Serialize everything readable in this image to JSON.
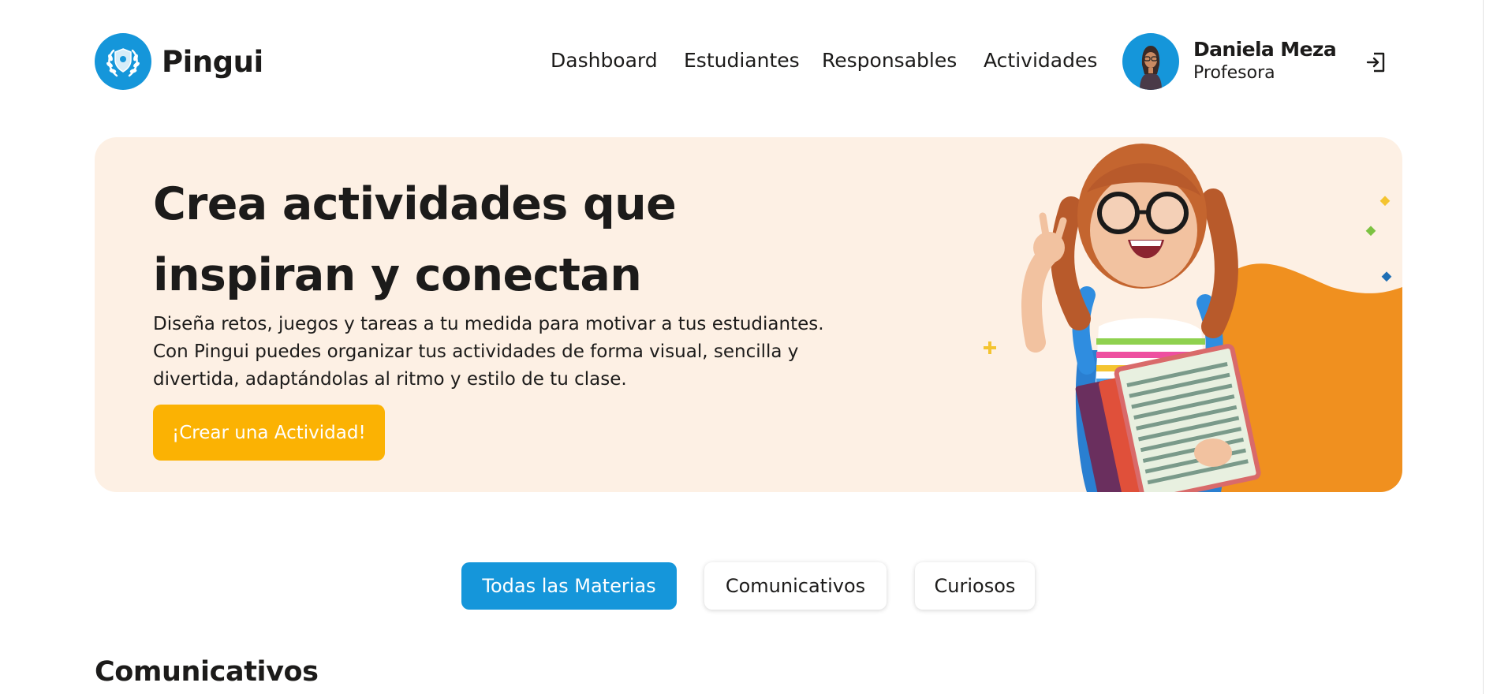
{
  "brand": {
    "name": "Pingui"
  },
  "nav": {
    "items": [
      {
        "label": "Dashboard"
      },
      {
        "label": "Estudiantes"
      },
      {
        "label": "Responsables"
      },
      {
        "label": "Actividades"
      }
    ]
  },
  "user": {
    "name": "Daniela Meza",
    "role": "Profesora"
  },
  "hero": {
    "title_lines": [
      "Crea actividades que",
      "inspiran y conectan"
    ],
    "description_lines": [
      "Diseña retos, juegos y tareas a tu medida para motivar a tus estudiantes.",
      "Con Pingui puedes organizar tus actividades de forma visual, sencilla y",
      "divertida, adaptándolas al ritmo y estilo de tu clase."
    ],
    "cta_label": "¡Crear una Actividad!"
  },
  "filters": {
    "items": [
      {
        "label": "Todas las Materias",
        "active": true
      },
      {
        "label": "Comunicativos",
        "active": false
      },
      {
        "label": "Curiosos",
        "active": false
      }
    ]
  },
  "section": {
    "title": "Comunicativos"
  },
  "colors": {
    "primary": "#1596da",
    "accent": "#fbb203",
    "hero_bg": "#fdf0e4",
    "hero_shape": "#f0901f",
    "text": "#1c1b1a"
  },
  "icons": {
    "logo": "laurel-shield-icon",
    "logout": "logout-icon",
    "hero_image": "girl-with-backpack-illustration"
  }
}
